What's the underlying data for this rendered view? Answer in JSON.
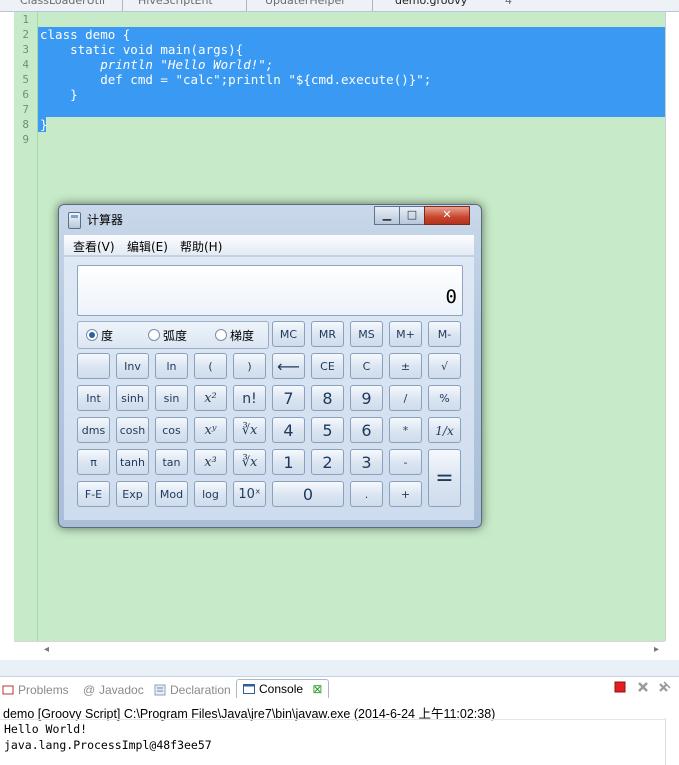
{
  "editor_tabs": [
    {
      "label": "ClassLoaderUtil"
    },
    {
      "label": "HiveScriptEnt"
    },
    {
      "label": "UpdaterHelper"
    },
    {
      "label": "demo.groovy"
    },
    {
      "label": "4"
    }
  ],
  "line_numbers": [
    "1",
    "2",
    "3",
    "4",
    "5",
    "6",
    "7",
    "8",
    "9"
  ],
  "code": [
    "",
    "class demo {",
    "    static void main(args){",
    "        println \"Hello World!\";",
    "        def cmd = \"calc\";println \"${cmd.execute()}\";",
    "    }",
    "",
    "}",
    ""
  ],
  "calculator": {
    "title": "计算器",
    "menu": [
      "查看(V)",
      "编辑(E)",
      "帮助(H)"
    ],
    "display": "0",
    "angle_modes": [
      {
        "label": "度",
        "selected": true
      },
      {
        "label": "弧度",
        "selected": false
      },
      {
        "label": "梯度",
        "selected": false
      }
    ],
    "memory_keys": [
      "MC",
      "MR",
      "MS",
      "M+",
      "M-"
    ],
    "rows": [
      [
        "",
        "Inv",
        "ln",
        "(",
        ")",
        "⟵",
        "CE",
        "C",
        "±",
        "√"
      ],
      [
        "Int",
        "sinh",
        "sin",
        "x²",
        "n!",
        "7",
        "8",
        "9",
        "/",
        "%"
      ],
      [
        "dms",
        "cosh",
        "cos",
        "xʸ",
        "∛x",
        "4",
        "5",
        "6",
        "*",
        "1/x"
      ],
      [
        "π",
        "tanh",
        "tan",
        "x³",
        "∛x",
        "1",
        "2",
        "3",
        "-",
        "="
      ],
      [
        "F-E",
        "Exp",
        "Mod",
        "log",
        "10ˣ",
        "0",
        ".",
        "+"
      ]
    ]
  },
  "console": {
    "tabs": [
      "Problems",
      "Javadoc",
      "Declaration",
      "Console"
    ],
    "active_tab": "Console",
    "title": "demo [Groovy Script] C:\\Program Files\\Java\\jre7\\bin\\javaw.exe (2014-6-24 上午11:02:38)",
    "output": [
      "Hello World!",
      "java.lang.ProcessImpl@48f3ee57"
    ]
  },
  "colors": {
    "editor_bg": "#c7ebc8",
    "selection": "#3a99f2",
    "terminate": "#e02020"
  }
}
